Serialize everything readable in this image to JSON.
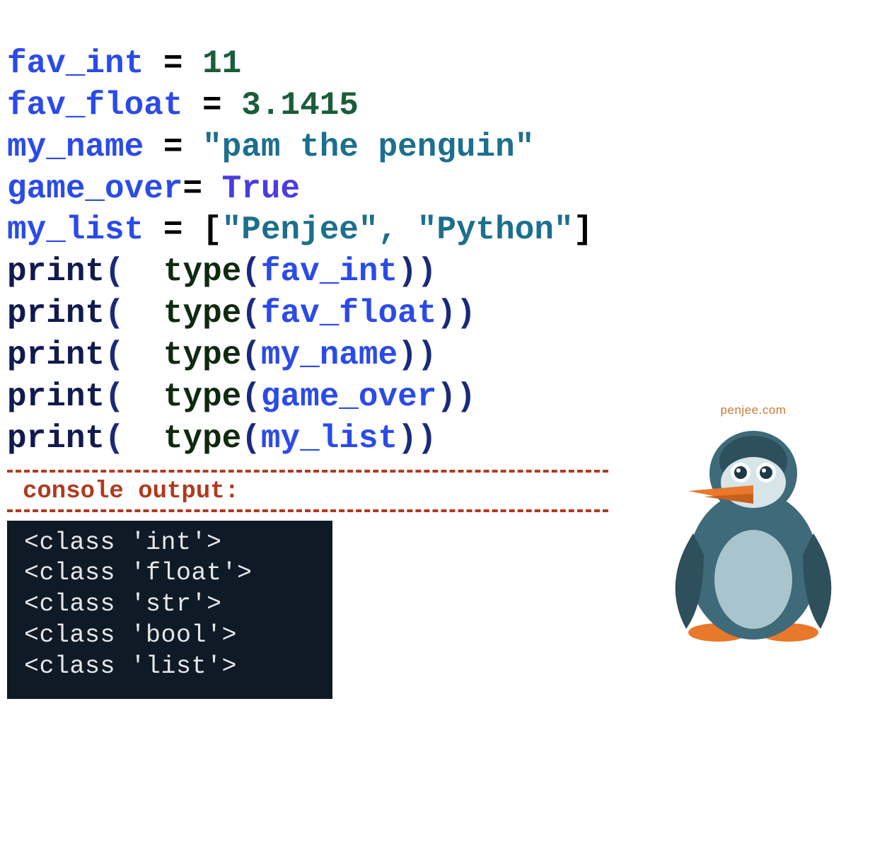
{
  "code": {
    "line1": {
      "var": "fav_int",
      "eq": " = ",
      "val": "11"
    },
    "line2": {
      "var": "fav_float",
      "eq": " = ",
      "val": "3.1415"
    },
    "line3": {
      "var": "my_name",
      "eq": " = ",
      "val": "\"pam the penguin\""
    },
    "line4": {
      "var": "game_over",
      "eq": "= ",
      "val": "True"
    },
    "line5": {
      "var": "my_list",
      "eq": " = ",
      "lbrk": "[",
      "s1": "\"Penjee\"",
      "comma": ", ",
      "s2": "\"Python\"",
      "rbrk": "]"
    },
    "print": "print",
    "type": "type",
    "po": "(",
    "pc": ")",
    "space": "  ",
    "args": {
      "l6": "fav_int",
      "l7": "fav_float",
      "l8": "my_name",
      "l9": "game_over",
      "l10": "my_list"
    }
  },
  "console_label": "console output:",
  "console_output": {
    "l1": "<class 'int'>",
    "l2": "<class 'float'>",
    "l3": "<class 'str'>",
    "l4": "<class 'bool'>",
    "l5": "<class 'list'>"
  },
  "penguin_caption": "penjee.com"
}
